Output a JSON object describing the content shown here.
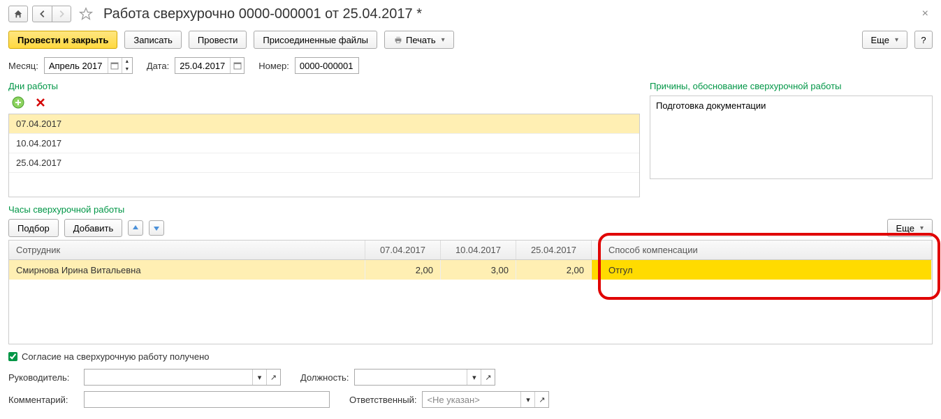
{
  "title": "Работа сверхурочно 0000-000001 от 25.04.2017 *",
  "toolbar": {
    "post_close": "Провести и закрыть",
    "save": "Записать",
    "post": "Провести",
    "attachments": "Присоединенные файлы",
    "print": "Печать",
    "more": "Еще",
    "help": "?"
  },
  "form": {
    "month_label": "Месяц:",
    "month_value": "Апрель 2017",
    "date_label": "Дата:",
    "date_value": "25.04.2017",
    "number_label": "Номер:",
    "number_value": "0000-000001"
  },
  "workdays": {
    "title": "Дни работы",
    "items": [
      "07.04.2017",
      "10.04.2017",
      "25.04.2017"
    ]
  },
  "reasons": {
    "title": "Причины, обоснование сверхурочной работы",
    "text": "Подготовка документации"
  },
  "hours": {
    "title": "Часы сверхурочной работы",
    "pick": "Подбор",
    "add": "Добавить",
    "more": "Еще",
    "headers": {
      "employee": "Сотрудник",
      "d1": "07.04.2017",
      "d2": "10.04.2017",
      "d3": "25.04.2017",
      "comp": "Способ компенсации"
    },
    "row": {
      "employee": "Смирнова Ирина Витальевна",
      "v1": "2,00",
      "v2": "3,00",
      "v3": "2,00",
      "comp": "Отгул"
    }
  },
  "consent": {
    "label": "Согласие на сверхурочную работу получено"
  },
  "footer": {
    "manager_label": "Руководитель:",
    "position_label": "Должность:",
    "comment_label": "Комментарий:",
    "responsible_label": "Ответственный:",
    "responsible_value": "<Не указан>"
  }
}
